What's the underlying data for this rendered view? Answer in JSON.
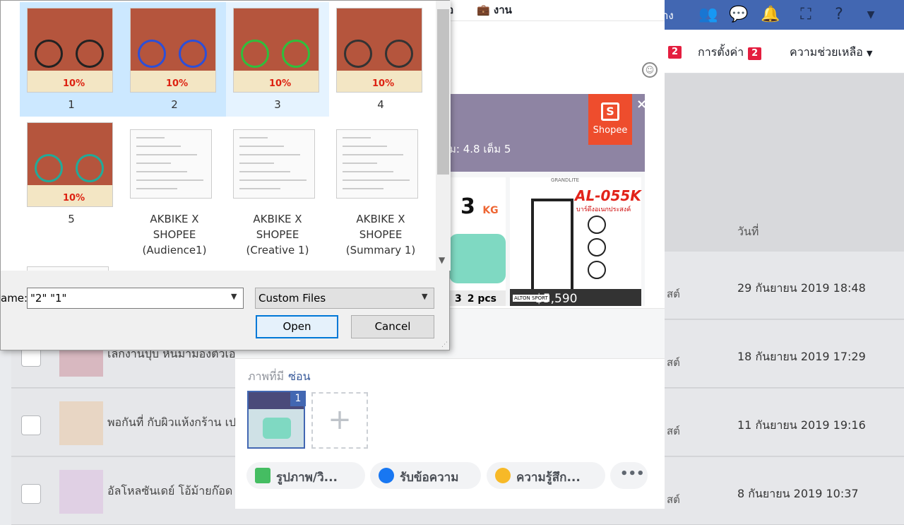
{
  "topbar": {
    "cut_text": "าง",
    "icons": [
      "friends-icon",
      "messenger-icon",
      "notifications-icon",
      "pages-icon",
      "help-icon",
      "dropdown-icon"
    ]
  },
  "subnav": {
    "badge_left": "2",
    "settings": "การตั้งค่า",
    "settings_badge": "2",
    "help": "ความช่วยเหลือ",
    "help_arrow": "▼"
  },
  "list": {
    "date_header": "วันที่",
    "rows": [
      {
        "status": "สต์",
        "title": "",
        "date": "29 กันยายน 2019 18:48"
      },
      {
        "status": "สต์",
        "title": "เลิกงานปุ๊บ หันมามองตัวเอ",
        "date": "18 กันยายน 2019 17:29"
      },
      {
        "status": "สต์",
        "title": "พอกันที่ กับผิวแห้งกร้าน เป",
        "date": "11 กันยายน 2019 19:16"
      },
      {
        "status": "สต์",
        "title": "อัลโหลซันเดย์ โอ้ม้ายก๊อด",
        "date": "8 กันยายน 2019 10:37"
      }
    ]
  },
  "composer": {
    "tab1": "นอ",
    "tab2": "งาน",
    "preview": {
      "rating": "ม: 4.8 เต็ม 5",
      "shopee_label": "Shopee",
      "shopee_letter": "S",
      "close": "×",
      "card1_weight": "3",
      "card1_unit": "KG",
      "card1_bottom_a": "3",
      "card1_bottom_b": "2 pcs",
      "card2_brand": "GRANDLITE",
      "card2_model": "AL-055K",
      "card2_sub": "บาร์ดึงอเนกประสงค์",
      "card2_sport": "ALTON SPORT",
      "card2_price": "฿5,590"
    },
    "photos_label": "ภาพที่มี",
    "hide_link": "ซ่อน",
    "attached_count": "1",
    "add_photo": "+",
    "actions": {
      "photo": "รูปภาพ/วิ...",
      "messages": "รับข้อความ",
      "feeling": "ความรู้สึก...",
      "more": "•••"
    }
  },
  "dialog": {
    "files": [
      {
        "name": "1",
        "kind": "bike",
        "state": "sel"
      },
      {
        "name": "2",
        "kind": "bike",
        "state": "sel"
      },
      {
        "name": "3",
        "kind": "bike",
        "state": "hov"
      },
      {
        "name": "4",
        "kind": "bike",
        "state": ""
      },
      {
        "name": "5",
        "kind": "bike",
        "state": ""
      },
      {
        "name": "AKBIKE X SHOPEE (Audience1)",
        "kind": "doc",
        "state": ""
      },
      {
        "name": "AKBIKE X SHOPEE (Creative 1)",
        "kind": "doc",
        "state": ""
      },
      {
        "name": "AKBIKE X SHOPEE (Summary 1)",
        "kind": "doc",
        "state": ""
      }
    ],
    "bike_pct": "10%",
    "filename_label": "ame:",
    "filename_value": "\"2\" \"1\"",
    "filetype": "Custom Files",
    "open": "Open",
    "cancel": "Cancel"
  },
  "colors": {
    "fb_blue": "#4267b2",
    "shopee": "#ee4d2d",
    "selected": "#cce8ff"
  }
}
